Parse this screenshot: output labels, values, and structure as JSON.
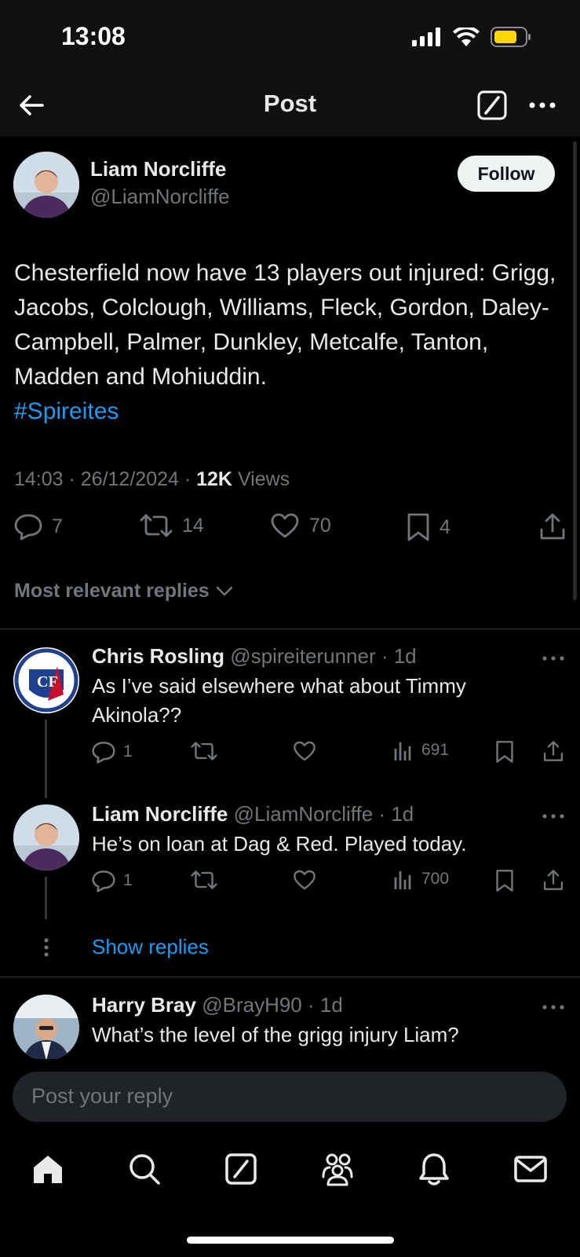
{
  "status": {
    "time": "13:08"
  },
  "header": {
    "title": "Post"
  },
  "post": {
    "author_name": "Liam Norcliffe",
    "author_handle": "@LiamNorcliffe",
    "follow_label": "Follow",
    "text": "Chesterfield now have 13 players out injured: Grigg, Jacobs, Colclough, Williams, Fleck, Gordon, Daley-Campbell, Palmer, Dunkley, Metcalfe, Tanton, Madden and Mohiuddin.",
    "hashtag": "#Spireites",
    "timestamp": "14:03 · 26/12/2024 · ",
    "views_count": "12K",
    "views_label": " Views",
    "replies": "7",
    "reposts": "14",
    "likes": "70",
    "bookmarks": "4"
  },
  "replies_sort": {
    "label": "Most relevant replies"
  },
  "replies": [
    {
      "name": "Chris Rosling",
      "handle": "@spireiterunner · 1d",
      "text": "As I’ve said elsewhere what about Timmy Akinola??",
      "replies": "1",
      "views": "691"
    },
    {
      "name": "Liam Norcliffe",
      "handle": "@LiamNorcliffe · 1d",
      "text": "He’s on loan at Dag & Red. Played today.",
      "replies": "1",
      "views": "700"
    },
    {
      "name": "Harry Bray",
      "handle": "@BrayH90 · 1d",
      "text": "What’s the level of the grigg injury Liam?"
    }
  ],
  "show_replies": "Show replies",
  "composer": {
    "placeholder": "Post your reply"
  },
  "colors": {
    "accent": "#1d9bf0",
    "background": "#000000",
    "muted": "#71767b"
  }
}
